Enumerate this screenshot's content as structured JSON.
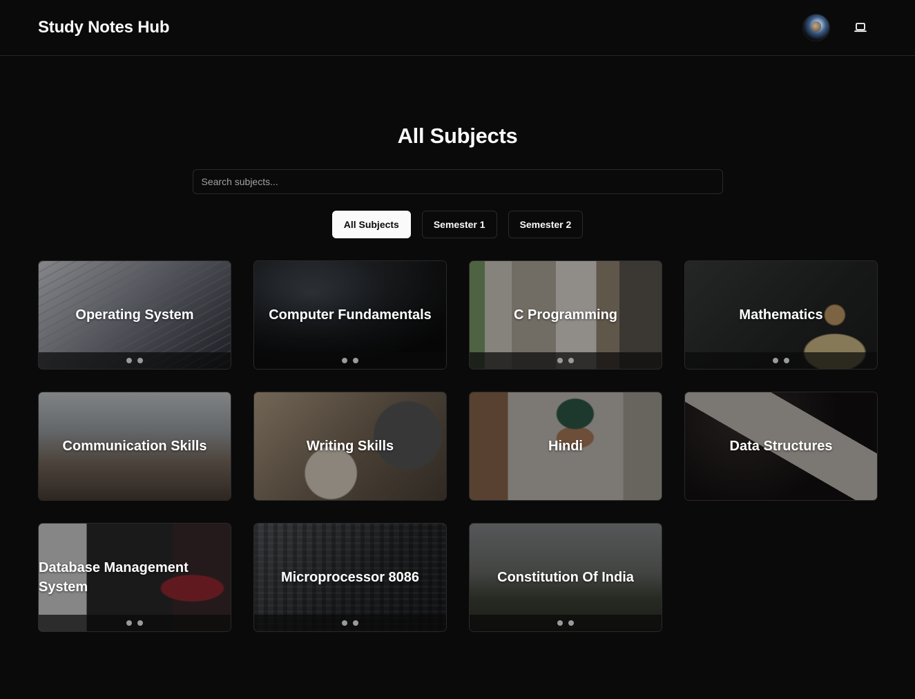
{
  "header": {
    "brand": "Study Notes Hub",
    "avatar_icon": "globe-avatar",
    "device_icon": "laptop-icon"
  },
  "main": {
    "title": "All Subjects",
    "search": {
      "placeholder": "Search subjects...",
      "value": ""
    },
    "filters": [
      {
        "label": "All Subjects",
        "active": true
      },
      {
        "label": "Semester 1",
        "active": false
      },
      {
        "label": "Semester 2",
        "active": false
      }
    ],
    "subjects": [
      {
        "title": "Operating System",
        "image": "bg-os",
        "dots": 2
      },
      {
        "title": "Computer Fundamentals",
        "image": "bg-cf",
        "dots": 2
      },
      {
        "title": "C Programming",
        "image": "bg-cp",
        "dots": 2
      },
      {
        "title": "Mathematics",
        "image": "bg-math",
        "dots": 2
      },
      {
        "title": "Communication Skills",
        "image": "bg-comm",
        "dots": 0
      },
      {
        "title": "Writing Skills",
        "image": "bg-write",
        "dots": 0
      },
      {
        "title": "Hindi",
        "image": "bg-hindi",
        "dots": 0
      },
      {
        "title": "Data Structures",
        "image": "bg-ds",
        "dots": 0
      },
      {
        "title": "Database Management System",
        "image": "bg-dbms",
        "dots": 2,
        "align": "left"
      },
      {
        "title": "Microprocessor 8086",
        "image": "bg-mp",
        "dots": 2
      },
      {
        "title": "Constitution Of India",
        "image": "bg-coi",
        "dots": 2
      }
    ]
  },
  "colors": {
    "background": "#0a0a0a",
    "border": "#2a2a2a",
    "text": "#fafafa",
    "muted": "#a1a1a1"
  }
}
